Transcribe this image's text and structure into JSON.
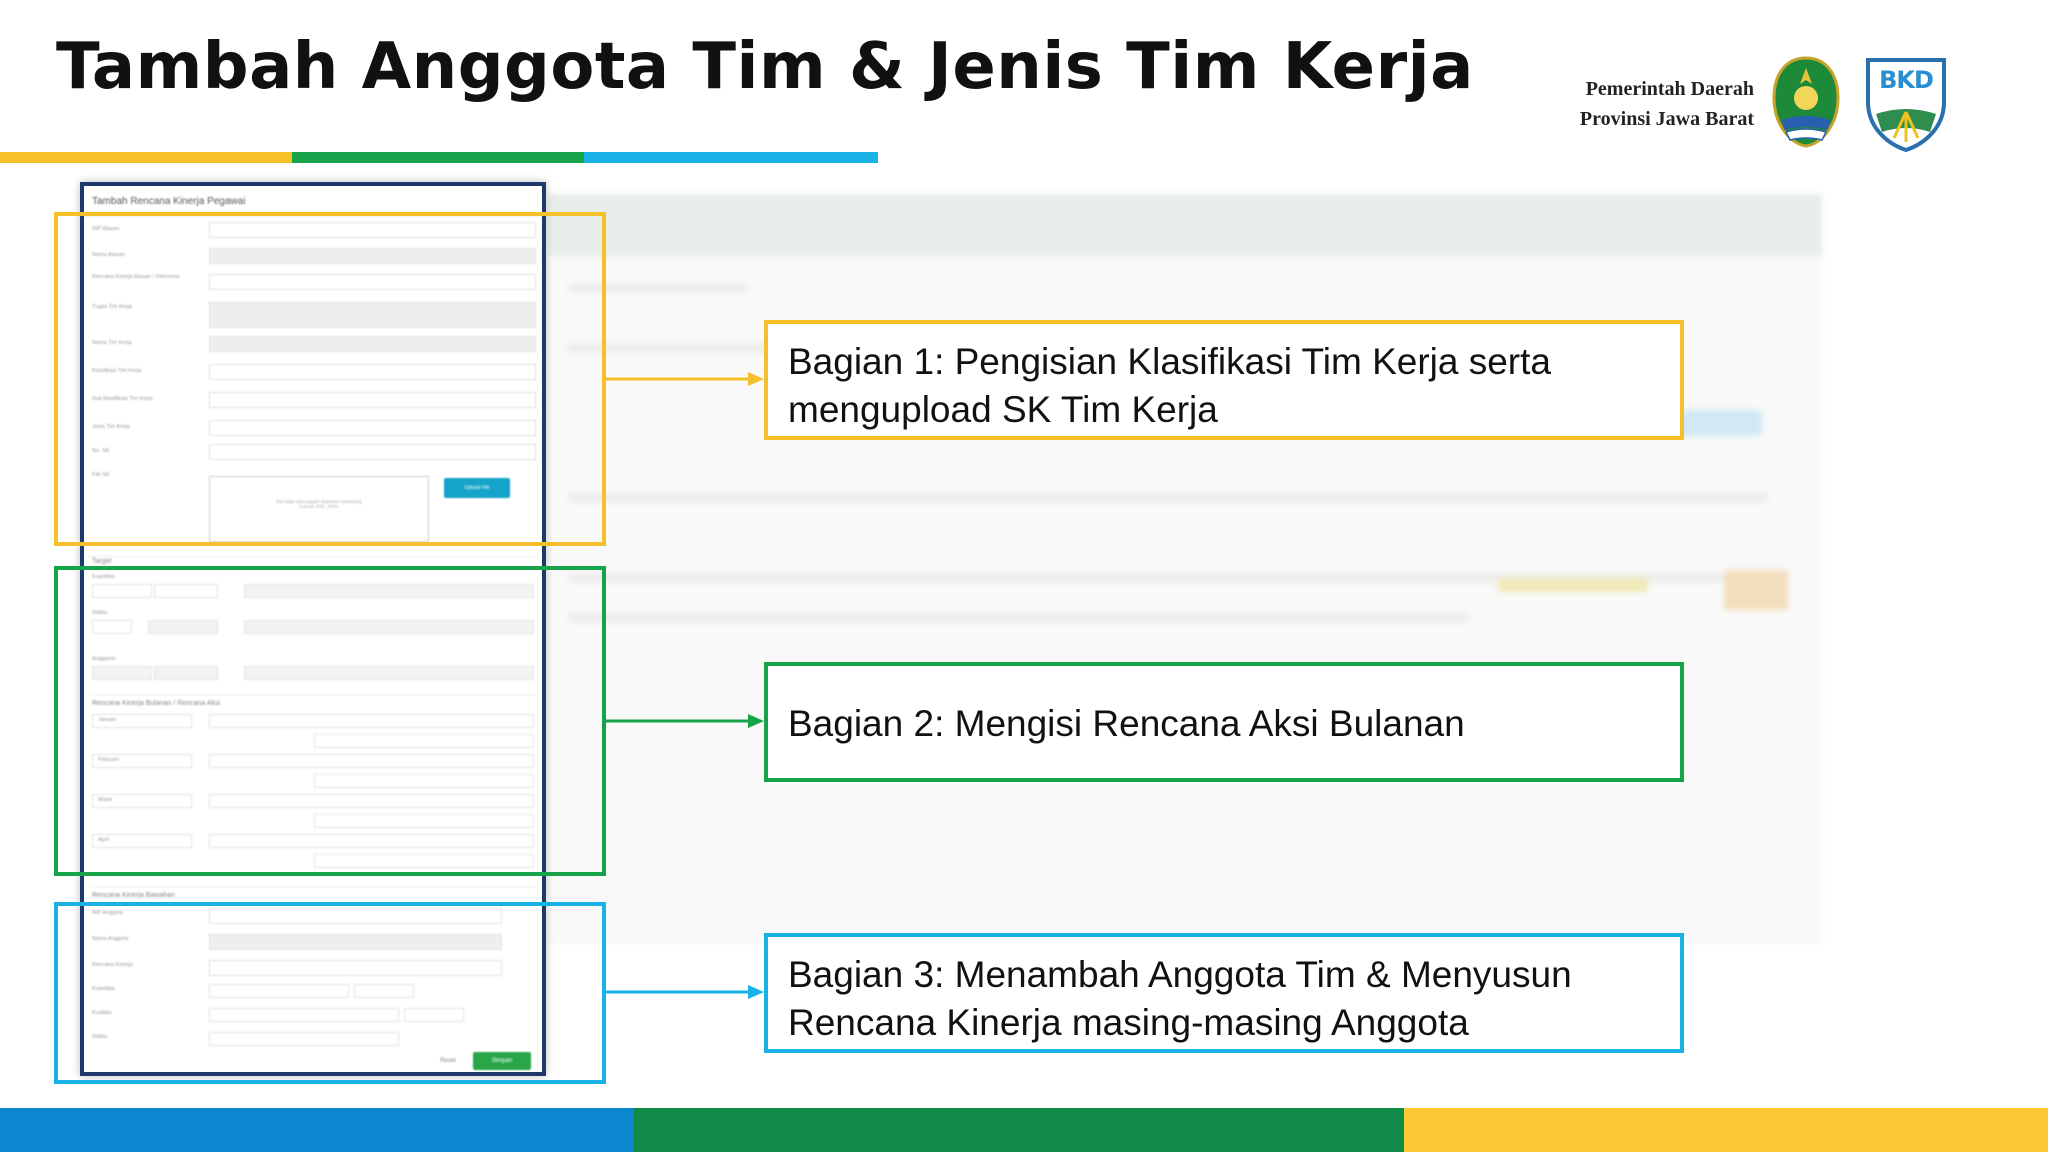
{
  "slide": {
    "title": "Tambah Anggota Tim & Jenis Tim Kerja",
    "gov_line1": "Pemerintah Daerah",
    "gov_line2": "Provinsi Jawa Barat",
    "bkd_logo_text": "BKD"
  },
  "colors": {
    "yellow": "#f5c02a",
    "green": "#17a34a",
    "blue": "#19b2e6",
    "footer_blue": "#0b86cf",
    "footer_green": "#0f8a47",
    "footer_yellow": "#fbc733",
    "navy": "#1f3a6a",
    "save_green": "#2aa64a",
    "upload_blue": "#16a3c9"
  },
  "callouts": [
    {
      "line1": "Bagian 1: Pengisian Klasifikasi Tim Kerja serta",
      "line2": "mengupload SK Tim Kerja"
    },
    {
      "line1": "Bagian 2: Mengisi Rencana Aksi Bulanan",
      "line2": ""
    },
    {
      "line1": "Bagian 3: Menambah Anggota Tim & Menyusun",
      "line2": "Rencana Kinerja masing-masing Anggota"
    }
  ],
  "form": {
    "title": "Tambah Rencana Kinerja Pegawai",
    "labels": [
      "NIP Atasan",
      "Nama Atasan",
      "Rencana Kinerja Atasan / Intervensi",
      "Tugas Tim Kerja",
      "Nama Tim Kerja",
      "Klasifikasi Tim Kerja",
      "Sub Klasifikasi Tim Kerja",
      "Jenis Tim Kerja",
      "No. SK",
      "File SK"
    ],
    "dropzone_line1": "Bila tidak ada unggah dokumen penunjang",
    "dropzone_line2": "Format: PDF, JPEG",
    "upload_label": "Upload File",
    "section_target": "Target",
    "target_labels": [
      "Kuantitas",
      "Waktu",
      "Anggaran"
    ],
    "section_rab": "Rencana Kinerja Bulanan / Rencana Aksi",
    "months": [
      "Januari",
      "Pebruari",
      "Maret",
      "April"
    ],
    "section_anggota": "Rencana Kinerja Bawahan",
    "anggota_labels": [
      "NIP Anggota",
      "Nama Anggota",
      "Rencana Kinerja",
      "Kuantitas",
      "Kualitas",
      "Waktu"
    ],
    "reset_label": "Reset",
    "save_label": "Simpan"
  }
}
